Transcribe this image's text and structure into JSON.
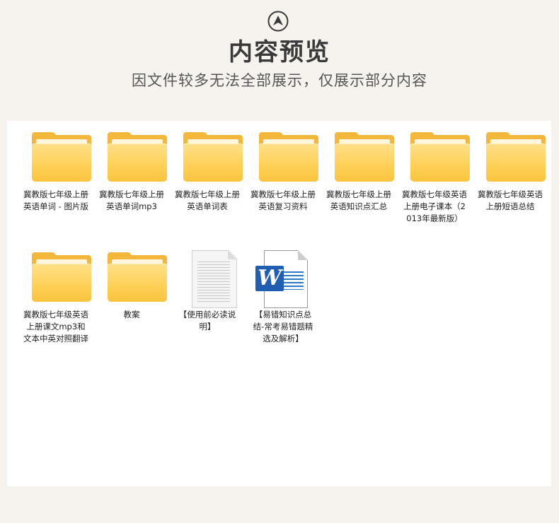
{
  "header": {
    "title": "内容预览",
    "subtitle": "因文件较多无法全部展示，仅展示部分内容",
    "logo_icon": "arrow-up-circle-icon"
  },
  "files": [
    {
      "name": "冀教版七年级上册英语单词 - 图片版",
      "type": "folder",
      "icon": "folder-icon"
    },
    {
      "name": "冀教版七年级上册英语单词mp3",
      "type": "folder",
      "icon": "folder-icon"
    },
    {
      "name": "冀教版七年级上册英语单词表",
      "type": "folder",
      "icon": "folder-icon"
    },
    {
      "name": "冀教版七年级上册英语复习资料",
      "type": "folder",
      "icon": "folder-icon"
    },
    {
      "name": "冀教版七年级上册英语知识点汇总",
      "type": "folder",
      "icon": "folder-icon"
    },
    {
      "name": "冀教版七年级英语上册电子课本（2013年最新版）",
      "type": "folder",
      "icon": "folder-icon"
    },
    {
      "name": "冀教版七年级英语上册短语总结",
      "type": "folder",
      "icon": "folder-icon"
    },
    {
      "name": "冀教版七年级英语上册课文mp3和文本中英对照翻译",
      "type": "folder",
      "icon": "folder-icon"
    },
    {
      "name": "教案",
      "type": "folder",
      "icon": "folder-icon"
    },
    {
      "name": "【使用前必读说明】",
      "type": "text",
      "icon": "text-document-icon"
    },
    {
      "name": "【易错知识点总结-常考易错题精选及解析】",
      "type": "word",
      "icon": "word-document-icon",
      "badge": "W"
    }
  ],
  "colors": {
    "background": "#f6f3ee",
    "panel": "#ffffff",
    "folder": "#ffd056",
    "word_blue": "#1f5eb0"
  }
}
